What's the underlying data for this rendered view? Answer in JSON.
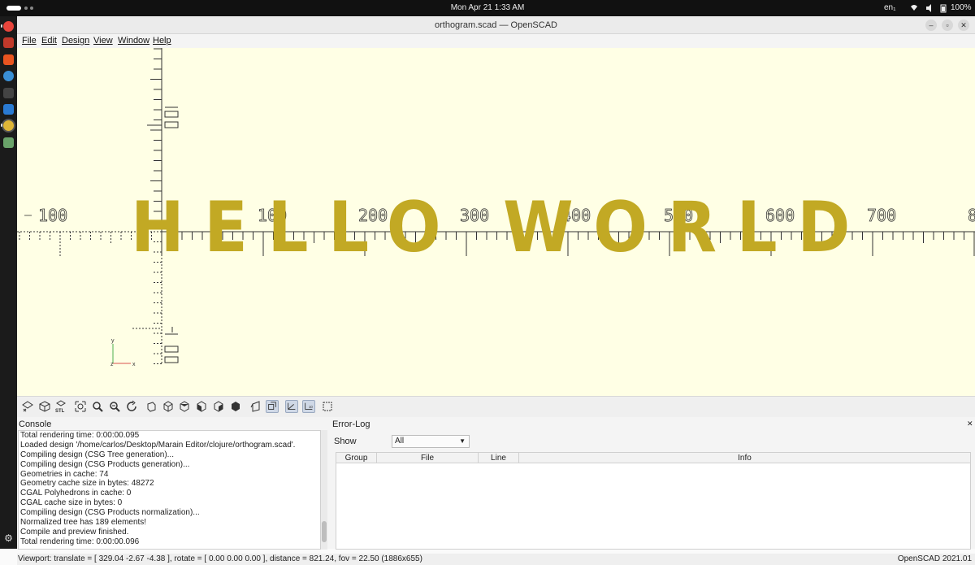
{
  "system_bar": {
    "clock": "Mon Apr 21   1:33 AM",
    "language": "en₁",
    "battery": "100%"
  },
  "dock": {
    "items": [
      {
        "name": "chrome-icon",
        "color": "#e8453c"
      },
      {
        "name": "files-icon",
        "color": "#c0392b"
      },
      {
        "name": "app-center-icon",
        "color": "#e95420"
      },
      {
        "name": "help-icon",
        "color": "#3a8fd6"
      },
      {
        "name": "terminal-icon",
        "color": "#444444"
      },
      {
        "name": "vscode-icon",
        "color": "#2a7ad3"
      },
      {
        "name": "openscad-icon",
        "color": "#e0b637"
      },
      {
        "name": "trash-icon",
        "color": "#6aa36a"
      }
    ]
  },
  "window": {
    "title": "orthogram.scad — OpenSCAD"
  },
  "menu": {
    "items": [
      "File",
      "Edit",
      "Design",
      "View",
      "Window",
      "Help"
    ]
  },
  "viewport": {
    "background": "#ffffe5",
    "text_color": "#c2a924",
    "ruler_labels": [
      "100",
      "100",
      "200",
      "300",
      "400",
      "500",
      "600",
      "700",
      "8"
    ],
    "rendered_text": "HELLO WORLD"
  },
  "console": {
    "title": "Console",
    "lines": [
      "Total rendering time: 0:00:00.095",
      "Loaded design '/home/carlos/Desktop/Marain Editor/clojure/orthogram.scad'.",
      "Compiling design (CSG Tree generation)...",
      "Compiling design (CSG Products generation)...",
      "Geometries in cache: 74",
      "Geometry cache size in bytes: 48272",
      "CGAL Polyhedrons in cache: 0",
      "CGAL cache size in bytes: 0",
      "Compiling design (CSG Products normalization)...",
      "Normalized tree has 189 elements!",
      "Compile and preview finished.",
      "Total rendering time: 0:00:00.096"
    ]
  },
  "error_log": {
    "title": "Error-Log",
    "show_label": "Show",
    "show_value": "All",
    "columns": [
      "Group",
      "File",
      "Line",
      "Info"
    ]
  },
  "status": {
    "viewport": "Viewport: translate = [ 329.04 -2.67 -4.38 ], rotate = [ 0.00 0.00 0.00 ], distance = 821.24, fov = 22.50 (1886x655)",
    "version": "OpenSCAD 2021.01"
  }
}
